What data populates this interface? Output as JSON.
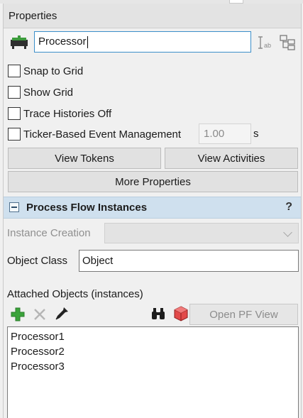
{
  "panel": {
    "title": "Properties",
    "object_name": "Processor",
    "name_icon": "processor-object-icon",
    "tool_icons": [
      "label-text-icon",
      "tree-hierarchy-icon"
    ]
  },
  "options": {
    "checkboxes": [
      {
        "label": "Snap to Grid",
        "checked": false
      },
      {
        "label": "Show Grid",
        "checked": false
      },
      {
        "label": "Trace Histories Off",
        "checked": false
      },
      {
        "label": "Ticker-Based Event Management",
        "checked": false
      }
    ],
    "ticker_value": "1.00",
    "ticker_unit": "s"
  },
  "buttons": {
    "view_tokens": "View Tokens",
    "view_activities": "View Activities",
    "more_properties": "More Properties"
  },
  "section": {
    "title": "Process Flow Instances",
    "help": "?",
    "instance_creation_label": "Instance Creation",
    "instance_creation_value": "",
    "object_class_label": "Object Class",
    "object_class_value": "Object",
    "attached_label": "Attached Objects (instances)",
    "toolbar_icons": [
      "add-icon",
      "remove-icon",
      "eyedropper-icon",
      "binoculars-icon",
      "cube-select-icon"
    ],
    "open_pf_view": "Open PF View",
    "attached_objects": [
      "Processor1",
      "Processor2",
      "Processor3"
    ]
  },
  "colors": {
    "section_bar": "#cfe0ee",
    "input_focus_border": "#3b8ec9",
    "add_green": "#3aa33a",
    "cube_red": "#d93a3a"
  }
}
